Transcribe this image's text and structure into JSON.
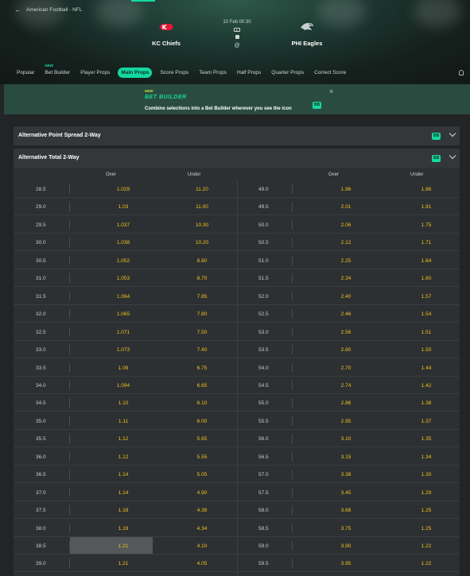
{
  "header": {
    "breadcrumb": "American Football - NFL",
    "kickoff": "10 Feb 00:30",
    "at_symbol": "@",
    "home_team": "KC Chiefs",
    "away_team": "PHI Eagles"
  },
  "tabs": [
    {
      "label": "Popular",
      "badge": ""
    },
    {
      "label": "Bet Builder",
      "badge": "NEW"
    },
    {
      "label": "Player Props",
      "badge": ""
    },
    {
      "label": "Main Props",
      "badge": "",
      "active": true
    },
    {
      "label": "Score Props",
      "badge": ""
    },
    {
      "label": "Team Props",
      "badge": ""
    },
    {
      "label": "Half Props",
      "badge": ""
    },
    {
      "label": "Quarter Props",
      "badge": ""
    },
    {
      "label": "Correct Score",
      "badge": ""
    }
  ],
  "banner": {
    "tag": "NEW",
    "title": "BET BUILDER",
    "message": "Combine selections into a Bet Builder wherever you see the icon",
    "badge": "BB"
  },
  "markets": [
    {
      "name": "Alternative Point Spread 2-Way",
      "badge": "BB"
    },
    {
      "name": "Alternative Total 2-Way",
      "badge": "BB"
    }
  ],
  "columns": {
    "over": "Over",
    "under": "Under"
  },
  "rows": [
    {
      "l1": "28.5",
      "o1": "1.029",
      "u1": "11.20",
      "l2": "49.0",
      "o2": "1.96",
      "u2": "1.86"
    },
    {
      "l1": "29.0",
      "o1": "1.03",
      "u1": "11.00",
      "l2": "49.5",
      "o2": "2.01",
      "u2": "1.81"
    },
    {
      "l1": "29.5",
      "o1": "1.037",
      "u1": "10.30",
      "l2": "50.0",
      "o2": "2.06",
      "u2": "1.75"
    },
    {
      "l1": "30.0",
      "o1": "1.038",
      "u1": "10.20",
      "l2": "50.5",
      "o2": "2.12",
      "u2": "1.71"
    },
    {
      "l1": "30.5",
      "o1": "1.052",
      "u1": "8.80",
      "l2": "51.0",
      "o2": "2.25",
      "u2": "1.64"
    },
    {
      "l1": "31.0",
      "o1": "1.053",
      "u1": "8.70",
      "l2": "51.5",
      "o2": "2.34",
      "u2": "1.60"
    },
    {
      "l1": "31.5",
      "o1": "1.064",
      "u1": "7.85",
      "l2": "52.0",
      "o2": "2.40",
      "u2": "1.57"
    },
    {
      "l1": "32.0",
      "o1": "1.065",
      "u1": "7.80",
      "l2": "52.5",
      "o2": "2.46",
      "u2": "1.54"
    },
    {
      "l1": "32.5",
      "o1": "1.071",
      "u1": "7.50",
      "l2": "53.0",
      "o2": "2.56",
      "u2": "1.51"
    },
    {
      "l1": "33.0",
      "o1": "1.073",
      "u1": "7.40",
      "l2": "53.5",
      "o2": "2.60",
      "u2": "1.50"
    },
    {
      "l1": "33.5",
      "o1": "1.09",
      "u1": "6.75",
      "l2": "54.0",
      "o2": "2.70",
      "u2": "1.44"
    },
    {
      "l1": "34.0",
      "o1": "1.094",
      "u1": "6.65",
      "l2": "54.5",
      "o2": "2.74",
      "u2": "1.42"
    },
    {
      "l1": "34.5",
      "o1": "1.10",
      "u1": "6.10",
      "l2": "55.0",
      "o2": "2.86",
      "u2": "1.38"
    },
    {
      "l1": "35.0",
      "o1": "1.11",
      "u1": "6.00",
      "l2": "55.5",
      "o2": "2.95",
      "u2": "1.37"
    },
    {
      "l1": "35.5",
      "o1": "1.12",
      "u1": "5.65",
      "l2": "56.0",
      "o2": "3.10",
      "u2": "1.35"
    },
    {
      "l1": "36.0",
      "o1": "1.12",
      "u1": "5.55",
      "l2": "56.5",
      "o2": "3.15",
      "u2": "1.34"
    },
    {
      "l1": "36.5",
      "o1": "1.14",
      "u1": "5.05",
      "l2": "57.0",
      "o2": "3.38",
      "u2": "1.30"
    },
    {
      "l1": "37.0",
      "o1": "1.14",
      "u1": "4.90",
      "l2": "57.5",
      "o2": "3.45",
      "u2": "1.29"
    },
    {
      "l1": "37.5",
      "o1": "1.18",
      "u1": "4.38",
      "l2": "58.0",
      "o2": "3.68",
      "u2": "1.25"
    },
    {
      "l1": "38.0",
      "o1": "1.19",
      "u1": "4.34",
      "l2": "58.5",
      "o2": "3.75",
      "u2": "1.25"
    },
    {
      "l1": "38.5",
      "o1": "1.21",
      "u1": "4.10",
      "l2": "59.0",
      "o2": "3.90",
      "u2": "1.22"
    },
    {
      "l1": "39.0",
      "o1": "1.21",
      "u1": "4.05",
      "l2": "59.5",
      "o2": "3.95",
      "u2": "1.22"
    }
  ],
  "colors": {
    "accent": "#14d8a0",
    "odds": "#f0c419",
    "panel": "#34373a"
  },
  "icons": [
    "back-arrow-icon",
    "chiefs-logo",
    "eagles-logo",
    "tv-icon",
    "stats-icon",
    "bell-icon",
    "close-icon",
    "chevron-down-icon"
  ]
}
